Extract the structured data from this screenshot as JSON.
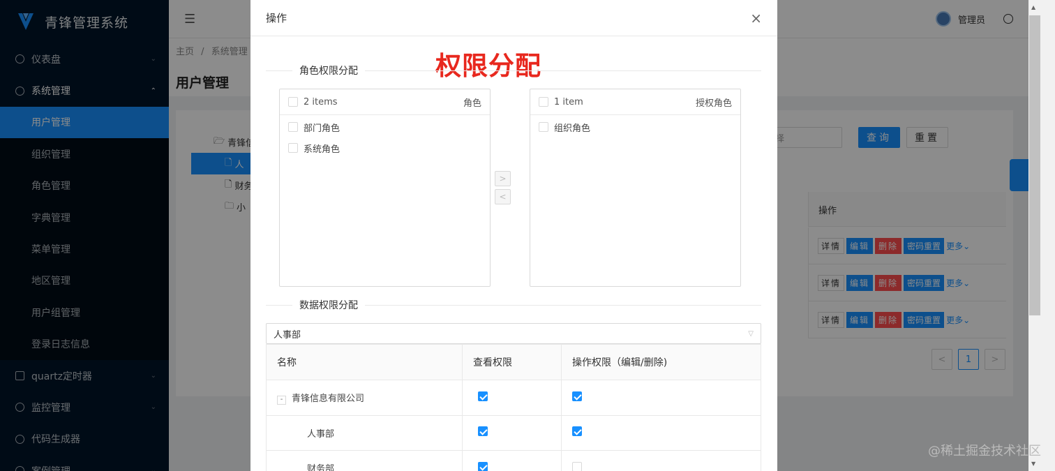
{
  "app": {
    "title": "青锋管理系统"
  },
  "sidebar": {
    "items": [
      {
        "label": "仪表盘",
        "arrow": "⌄"
      },
      {
        "label": "系统管理",
        "arrow": "⌃"
      },
      {
        "label": "quartz定时器",
        "arrow": "⌄"
      },
      {
        "label": "监控管理",
        "arrow": "⌄"
      },
      {
        "label": "代码生成器"
      },
      {
        "label": "案例管理",
        "arrow": "⌄"
      }
    ],
    "subitems": [
      {
        "label": "用户管理"
      },
      {
        "label": "组织管理"
      },
      {
        "label": "角色管理"
      },
      {
        "label": "字典管理"
      },
      {
        "label": "菜单管理"
      },
      {
        "label": "地区管理"
      },
      {
        "label": "用户组管理"
      },
      {
        "label": "登录日志信息"
      }
    ]
  },
  "topbar": {
    "fold_icon": "☰",
    "user": "管理员"
  },
  "breadcrumb": {
    "home": "主页",
    "sep": "/",
    "current": "系统管理"
  },
  "page": {
    "title": "用户管理"
  },
  "tree": [
    "青锋信",
    "人",
    "财务",
    "小"
  ],
  "search": {
    "select_placeholder": "择",
    "query": "查询",
    "reset": "重置"
  },
  "table": {
    "ops_header": "操作",
    "row_actions": {
      "detail": "详情",
      "edit": "编辑",
      "delete": "删除",
      "reset_pwd": "密码重置",
      "more": "更多⌄"
    }
  },
  "pager": {
    "prev": "<",
    "page": "1",
    "next": ">"
  },
  "modal": {
    "title": "操作",
    "close": "×",
    "annotation": "权限分配",
    "role_section": "角色权限分配",
    "data_section": "数据权限分配",
    "left_list": {
      "count": "2 items",
      "title": "角色",
      "items": [
        "部门角色",
        "系统角色"
      ]
    },
    "right_list": {
      "count": "1 item",
      "title": "授权角色",
      "items": [
        "组织角色"
      ]
    },
    "move_right": ">",
    "move_left": "<",
    "dept_select": "人事部",
    "perm_table": {
      "headers": [
        "名称",
        "查看权限",
        "操作权限（编辑/删除)"
      ],
      "rows": [
        {
          "name": "青锋信息有限公司",
          "expand": "-",
          "view": true,
          "edit": true
        },
        {
          "name": "人事部",
          "view": true,
          "edit": true
        },
        {
          "name": "财务部",
          "view": true,
          "edit": false
        }
      ]
    }
  },
  "watermark": "@稀土掘金技术社区",
  "colors": {
    "primary": "#1890ff",
    "danger": "#ff4d4f",
    "sidebar": "#001529",
    "annotation": "#e8281e"
  }
}
